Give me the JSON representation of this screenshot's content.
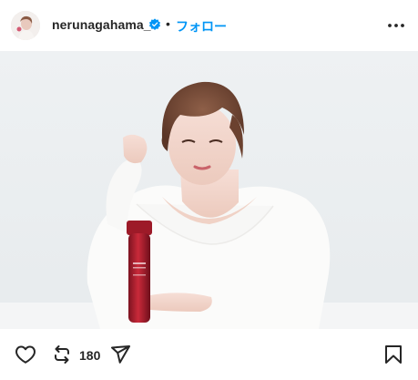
{
  "post": {
    "username": "nerunagahama_",
    "separator": "•",
    "follow_label": "フォロー",
    "repost_count": "180"
  },
  "icons": {
    "avatar": "profile-avatar",
    "verified": "verified-badge-icon",
    "more": "more-options-icon",
    "like": "heart-icon",
    "repost": "repost-icon",
    "share": "share-icon",
    "save": "bookmark-icon"
  },
  "colors": {
    "accent": "#0095f6",
    "text": "#262626",
    "product_bottle": "#b0202f"
  }
}
